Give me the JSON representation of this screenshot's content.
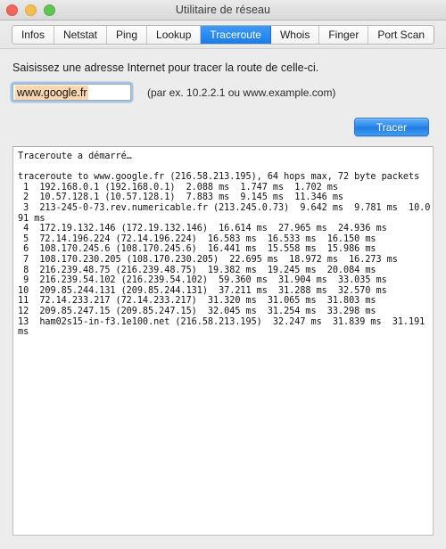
{
  "window": {
    "title": "Utilitaire de réseau",
    "traffic_lights": [
      {
        "name": "close",
        "color": "#f2655b"
      },
      {
        "name": "minimize",
        "color": "#f5bd4f"
      },
      {
        "name": "zoom",
        "color": "#61c454"
      }
    ]
  },
  "tabs": [
    {
      "label": "Infos",
      "active": false
    },
    {
      "label": "Netstat",
      "active": false
    },
    {
      "label": "Ping",
      "active": false
    },
    {
      "label": "Lookup",
      "active": false
    },
    {
      "label": "Traceroute",
      "active": true
    },
    {
      "label": "Whois",
      "active": false
    },
    {
      "label": "Finger",
      "active": false
    },
    {
      "label": "Port Scan",
      "active": false
    }
  ],
  "main": {
    "instruction": "Saisissez une adresse Internet pour tracer la route de celle-ci.",
    "address_input": {
      "value": "www.google.fr",
      "placeholder": "",
      "selected": true,
      "selection_color": "#fad7b0",
      "focus_ring_color": "#6aa6e2"
    },
    "hint": "(par ex. 10.2.2.1 ou www.example.com)",
    "trace_button": {
      "label": "Tracer",
      "accent_color": "#2a86ec"
    },
    "output": "Traceroute a démarré…\n\ntraceroute to www.google.fr (216.58.213.195), 64 hops max, 72 byte packets\n 1  192.168.0.1 (192.168.0.1)  2.088 ms  1.747 ms  1.702 ms\n 2  10.57.128.1 (10.57.128.1)  7.883 ms  9.145 ms  11.346 ms\n 3  213-245-0-73.rev.numericable.fr (213.245.0.73)  9.642 ms  9.781 ms  10.091 ms\n 4  172.19.132.146 (172.19.132.146)  16.614 ms  27.965 ms  24.936 ms\n 5  72.14.196.224 (72.14.196.224)  16.583 ms  16.533 ms  16.150 ms\n 6  108.170.245.6 (108.170.245.6)  16.441 ms  15.558 ms  15.986 ms\n 7  108.170.230.205 (108.170.230.205)  22.695 ms  18.972 ms  16.273 ms\n 8  216.239.48.75 (216.239.48.75)  19.382 ms  19.245 ms  20.084 ms\n 9  216.239.54.102 (216.239.54.102)  59.360 ms  31.904 ms  33.035 ms\n10  209.85.244.131 (209.85.244.131)  37.211 ms  31.288 ms  32.570 ms\n11  72.14.233.217 (72.14.233.217)  31.320 ms  31.065 ms  31.803 ms\n12  209.85.247.15 (209.85.247.15)  32.045 ms  31.254 ms  33.298 ms\n13  ham02s15-in-f3.1e100.net (216.58.213.195)  32.247 ms  31.839 ms  31.191 ms\n"
  },
  "trace_data": {
    "target_host": "www.google.fr",
    "target_ip": "216.58.213.195",
    "max_hops": 64,
    "packet_bytes": 72,
    "status": "Traceroute a démarré…",
    "hops": [
      {
        "hop": 1,
        "host": "192.168.0.1",
        "ip": "192.168.0.1",
        "rtt_ms": [
          2.088,
          1.747,
          1.702
        ]
      },
      {
        "hop": 2,
        "host": "10.57.128.1",
        "ip": "10.57.128.1",
        "rtt_ms": [
          7.883,
          9.145,
          11.346
        ]
      },
      {
        "hop": 3,
        "host": "213-245-0-73.rev.numericable.fr",
        "ip": "213.245.0.73",
        "rtt_ms": [
          9.642,
          9.781,
          10.091
        ]
      },
      {
        "hop": 4,
        "host": "172.19.132.146",
        "ip": "172.19.132.146",
        "rtt_ms": [
          16.614,
          27.965,
          24.936
        ]
      },
      {
        "hop": 5,
        "host": "72.14.196.224",
        "ip": "72.14.196.224",
        "rtt_ms": [
          16.583,
          16.533,
          16.15
        ]
      },
      {
        "hop": 6,
        "host": "108.170.245.6",
        "ip": "108.170.245.6",
        "rtt_ms": [
          16.441,
          15.558,
          15.986
        ]
      },
      {
        "hop": 7,
        "host": "108.170.230.205",
        "ip": "108.170.230.205",
        "rtt_ms": [
          22.695,
          18.972,
          16.273
        ]
      },
      {
        "hop": 8,
        "host": "216.239.48.75",
        "ip": "216.239.48.75",
        "rtt_ms": [
          19.382,
          19.245,
          20.084
        ]
      },
      {
        "hop": 9,
        "host": "216.239.54.102",
        "ip": "216.239.54.102",
        "rtt_ms": [
          59.36,
          31.904,
          33.035
        ]
      },
      {
        "hop": 10,
        "host": "209.85.244.131",
        "ip": "209.85.244.131",
        "rtt_ms": [
          37.211,
          31.288,
          32.57
        ]
      },
      {
        "hop": 11,
        "host": "72.14.233.217",
        "ip": "72.14.233.217",
        "rtt_ms": [
          31.32,
          31.065,
          31.803
        ]
      },
      {
        "hop": 12,
        "host": "209.85.247.15",
        "ip": "209.85.247.15",
        "rtt_ms": [
          32.045,
          31.254,
          33.298
        ]
      },
      {
        "hop": 13,
        "host": "ham02s15-in-f3.1e100.net",
        "ip": "216.58.213.195",
        "rtt_ms": [
          32.247,
          31.839,
          31.191
        ]
      }
    ]
  }
}
